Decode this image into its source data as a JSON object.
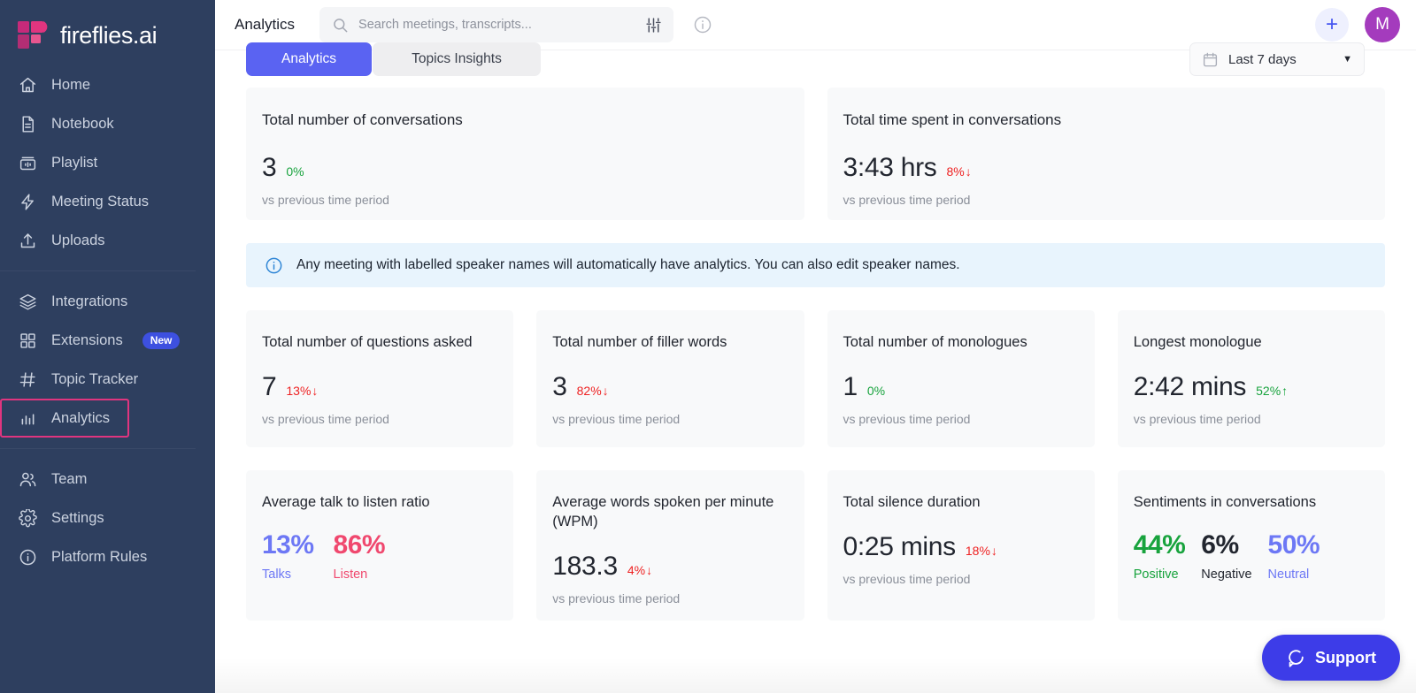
{
  "brand": {
    "name": "fireflies.ai",
    "logo_icon": "fireflies-logo-icon"
  },
  "sidebar": {
    "groups": [
      {
        "items": [
          {
            "label": "Home",
            "icon": "home-icon"
          },
          {
            "label": "Notebook",
            "icon": "document-icon"
          },
          {
            "label": "Playlist",
            "icon": "playlist-icon"
          },
          {
            "label": "Meeting Status",
            "icon": "lightning-icon"
          },
          {
            "label": "Uploads",
            "icon": "upload-icon"
          }
        ]
      },
      {
        "items": [
          {
            "label": "Integrations",
            "icon": "layers-icon"
          },
          {
            "label": "Extensions",
            "icon": "grid-icon",
            "badge": "New"
          },
          {
            "label": "Topic Tracker",
            "icon": "hash-icon"
          },
          {
            "label": "Analytics",
            "icon": "bar-chart-icon",
            "highlighted": true
          }
        ]
      },
      {
        "items": [
          {
            "label": "Team",
            "icon": "people-icon"
          },
          {
            "label": "Settings",
            "icon": "gear-icon"
          },
          {
            "label": "Platform Rules",
            "icon": "info-circle-icon"
          }
        ]
      }
    ],
    "highlight_color": "#e0357f",
    "background_color": "#2e3f5f"
  },
  "header": {
    "title": "Analytics",
    "search": {
      "placeholder": "Search meetings, transcripts...",
      "value": "",
      "icon": "search-icon",
      "filter_icon": "filter-sliders-icon"
    },
    "info_icon": "info-circle-icon",
    "add_button": {
      "icon": "plus-icon",
      "label": "+"
    },
    "avatar": {
      "initial": "M",
      "color": "#a43bbd"
    }
  },
  "toolbar": {
    "tabs": [
      {
        "label": "Analytics",
        "active": true
      },
      {
        "label": "Topics Insights",
        "active": false
      }
    ],
    "date_filter": {
      "label": "Last 7 days",
      "icon": "calendar-icon",
      "caret": "▼"
    }
  },
  "banner": {
    "icon": "info-circle-icon",
    "text": "Any meeting with labelled speaker names will automatically have analytics. You can also edit speaker names."
  },
  "metrics": {
    "row1": [
      {
        "title": "Total number of conversations",
        "value": "3",
        "delta": "0%",
        "direction": "flat",
        "arrow": "",
        "note": "vs previous time period"
      },
      {
        "title": "Total time spent in conversations",
        "value": "3:43 hrs",
        "delta": "8%",
        "direction": "down",
        "arrow": "↓",
        "note": "vs previous time period"
      }
    ],
    "row2": [
      {
        "title": "Total number of questions asked",
        "value": "7",
        "delta": "13%",
        "direction": "down",
        "arrow": "↓",
        "note": "vs previous time period"
      },
      {
        "title": "Total number of filler words",
        "value": "3",
        "delta": "82%",
        "direction": "down",
        "arrow": "↓",
        "note": "vs previous time period"
      },
      {
        "title": "Total number of monologues",
        "value": "1",
        "delta": "0%",
        "direction": "flat",
        "arrow": "",
        "note": "vs previous time period"
      },
      {
        "title": "Longest monologue",
        "value": "2:42 mins",
        "delta": "52%",
        "direction": "up",
        "arrow": "↑",
        "note": "vs previous time period"
      }
    ],
    "talk_listen": {
      "title": "Average talk to listen ratio",
      "talks_value": "13%",
      "talks_label": "Talks",
      "talks_color": "#6d78f5",
      "listen_value": "86%",
      "listen_label": "Listen",
      "listen_color": "#f0486e"
    },
    "wpm": {
      "title": "Average words spoken per minute (WPM)",
      "value": "183.3",
      "delta": "4%",
      "direction": "down",
      "arrow": "↓",
      "note": "vs previous time period"
    },
    "silence": {
      "title": "Total silence duration",
      "value": "0:25 mins",
      "delta": "18%",
      "direction": "down",
      "arrow": "↓",
      "note": "vs previous time period"
    },
    "sentiments": {
      "title": "Sentiments in conversations",
      "items": [
        {
          "value": "44%",
          "label": "Positive",
          "color": "#18a33d"
        },
        {
          "value": "6%",
          "label": "Negative",
          "color": "#22262f"
        },
        {
          "value": "50%",
          "label": "Neutral",
          "color": "#6d78f5"
        }
      ]
    }
  },
  "support": {
    "label": "Support",
    "icon": "chat-bubble-icon",
    "color": "#3d3ce8"
  }
}
